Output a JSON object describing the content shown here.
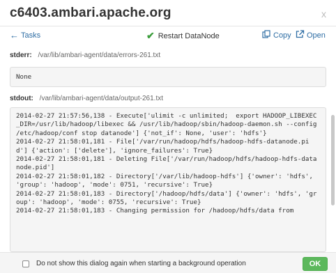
{
  "dialog": {
    "title": "c6403.ambari.apache.org",
    "close_label": "x"
  },
  "toolbar": {
    "back_label": "Tasks",
    "task_status": "Restart DataNode",
    "copy_label": "Copy",
    "open_label": "Open"
  },
  "stderr": {
    "label": "stderr:",
    "path": "/var/lib/ambari-agent/data/errors-261.txt",
    "content": "None"
  },
  "stdout": {
    "label": "stdout:",
    "path": "/var/lib/ambari-agent/data/output-261.txt",
    "content": "2014-02-27 21:57:56,138 - Execute['ulimit -c unlimited;  export HADOOP_LIBEXEC_DIR=/usr/lib/hadoop/libexec && /usr/lib/hadoop/sbin/hadoop-daemon.sh --config /etc/hadoop/conf stop datanode'] {'not_if': None, 'user': 'hdfs'}\n2014-02-27 21:58:01,181 - File['/var/run/hadoop/hdfs/hadoop-hdfs-datanode.pid'] {'action': ['delete'], 'ignore_failures': True}\n2014-02-27 21:58:01,181 - Deleting File['/var/run/hadoop/hdfs/hadoop-hdfs-datanode.pid']\n2014-02-27 21:58:01,182 - Directory['/var/lib/hadoop-hdfs'] {'owner': 'hdfs', 'group': 'hadoop', 'mode': 0751, 'recursive': True}\n2014-02-27 21:58:01,183 - Directory['/hadoop/hdfs/data'] {'owner': 'hdfs', 'group': 'hadoop', 'mode': 0755, 'recursive': True}\n2014-02-27 21:58:01,183 - Changing permission for /hadoop/hdfs/data from"
  },
  "footer": {
    "checkbox_label": "Do not show this dialog again when starting a background operation",
    "ok_label": "OK"
  },
  "colors": {
    "link": "#2e6da4",
    "success": "#5cb85c",
    "check": "#3c9d3c"
  }
}
